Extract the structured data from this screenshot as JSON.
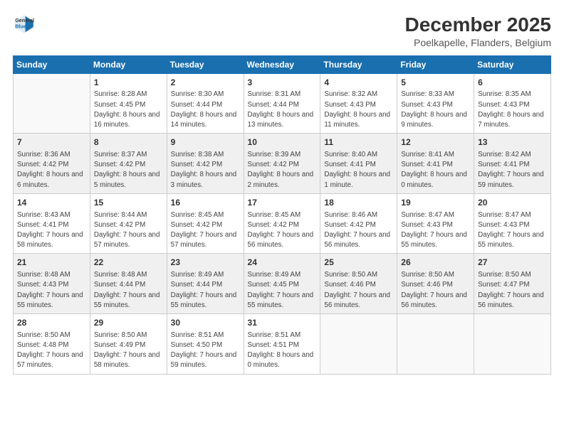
{
  "logo": {
    "line1": "General",
    "line2": "Blue"
  },
  "title": "December 2025",
  "subtitle": "Poelkapelle, Flanders, Belgium",
  "days_of_week": [
    "Sunday",
    "Monday",
    "Tuesday",
    "Wednesday",
    "Thursday",
    "Friday",
    "Saturday"
  ],
  "weeks": [
    [
      {
        "day": "",
        "info": ""
      },
      {
        "day": "1",
        "info": "Sunrise: 8:28 AM\nSunset: 4:45 PM\nDaylight: 8 hours\nand 16 minutes."
      },
      {
        "day": "2",
        "info": "Sunrise: 8:30 AM\nSunset: 4:44 PM\nDaylight: 8 hours\nand 14 minutes."
      },
      {
        "day": "3",
        "info": "Sunrise: 8:31 AM\nSunset: 4:44 PM\nDaylight: 8 hours\nand 13 minutes."
      },
      {
        "day": "4",
        "info": "Sunrise: 8:32 AM\nSunset: 4:43 PM\nDaylight: 8 hours\nand 11 minutes."
      },
      {
        "day": "5",
        "info": "Sunrise: 8:33 AM\nSunset: 4:43 PM\nDaylight: 8 hours\nand 9 minutes."
      },
      {
        "day": "6",
        "info": "Sunrise: 8:35 AM\nSunset: 4:43 PM\nDaylight: 8 hours\nand 7 minutes."
      }
    ],
    [
      {
        "day": "7",
        "info": "Sunrise: 8:36 AM\nSunset: 4:42 PM\nDaylight: 8 hours\nand 6 minutes."
      },
      {
        "day": "8",
        "info": "Sunrise: 8:37 AM\nSunset: 4:42 PM\nDaylight: 8 hours\nand 5 minutes."
      },
      {
        "day": "9",
        "info": "Sunrise: 8:38 AM\nSunset: 4:42 PM\nDaylight: 8 hours\nand 3 minutes."
      },
      {
        "day": "10",
        "info": "Sunrise: 8:39 AM\nSunset: 4:42 PM\nDaylight: 8 hours\nand 2 minutes."
      },
      {
        "day": "11",
        "info": "Sunrise: 8:40 AM\nSunset: 4:41 PM\nDaylight: 8 hours\nand 1 minute."
      },
      {
        "day": "12",
        "info": "Sunrise: 8:41 AM\nSunset: 4:41 PM\nDaylight: 8 hours\nand 0 minutes."
      },
      {
        "day": "13",
        "info": "Sunrise: 8:42 AM\nSunset: 4:41 PM\nDaylight: 7 hours\nand 59 minutes."
      }
    ],
    [
      {
        "day": "14",
        "info": "Sunrise: 8:43 AM\nSunset: 4:41 PM\nDaylight: 7 hours\nand 58 minutes."
      },
      {
        "day": "15",
        "info": "Sunrise: 8:44 AM\nSunset: 4:42 PM\nDaylight: 7 hours\nand 57 minutes."
      },
      {
        "day": "16",
        "info": "Sunrise: 8:45 AM\nSunset: 4:42 PM\nDaylight: 7 hours\nand 57 minutes."
      },
      {
        "day": "17",
        "info": "Sunrise: 8:45 AM\nSunset: 4:42 PM\nDaylight: 7 hours\nand 56 minutes."
      },
      {
        "day": "18",
        "info": "Sunrise: 8:46 AM\nSunset: 4:42 PM\nDaylight: 7 hours\nand 56 minutes."
      },
      {
        "day": "19",
        "info": "Sunrise: 8:47 AM\nSunset: 4:43 PM\nDaylight: 7 hours\nand 55 minutes."
      },
      {
        "day": "20",
        "info": "Sunrise: 8:47 AM\nSunset: 4:43 PM\nDaylight: 7 hours\nand 55 minutes."
      }
    ],
    [
      {
        "day": "21",
        "info": "Sunrise: 8:48 AM\nSunset: 4:43 PM\nDaylight: 7 hours\nand 55 minutes."
      },
      {
        "day": "22",
        "info": "Sunrise: 8:48 AM\nSunset: 4:44 PM\nDaylight: 7 hours\nand 55 minutes."
      },
      {
        "day": "23",
        "info": "Sunrise: 8:49 AM\nSunset: 4:44 PM\nDaylight: 7 hours\nand 55 minutes."
      },
      {
        "day": "24",
        "info": "Sunrise: 8:49 AM\nSunset: 4:45 PM\nDaylight: 7 hours\nand 55 minutes."
      },
      {
        "day": "25",
        "info": "Sunrise: 8:50 AM\nSunset: 4:46 PM\nDaylight: 7 hours\nand 56 minutes."
      },
      {
        "day": "26",
        "info": "Sunrise: 8:50 AM\nSunset: 4:46 PM\nDaylight: 7 hours\nand 56 minutes."
      },
      {
        "day": "27",
        "info": "Sunrise: 8:50 AM\nSunset: 4:47 PM\nDaylight: 7 hours\nand 56 minutes."
      }
    ],
    [
      {
        "day": "28",
        "info": "Sunrise: 8:50 AM\nSunset: 4:48 PM\nDaylight: 7 hours\nand 57 minutes."
      },
      {
        "day": "29",
        "info": "Sunrise: 8:50 AM\nSunset: 4:49 PM\nDaylight: 7 hours\nand 58 minutes."
      },
      {
        "day": "30",
        "info": "Sunrise: 8:51 AM\nSunset: 4:50 PM\nDaylight: 7 hours\nand 59 minutes."
      },
      {
        "day": "31",
        "info": "Sunrise: 8:51 AM\nSunset: 4:51 PM\nDaylight: 8 hours\nand 0 minutes."
      },
      {
        "day": "",
        "info": ""
      },
      {
        "day": "",
        "info": ""
      },
      {
        "day": "",
        "info": ""
      }
    ]
  ]
}
